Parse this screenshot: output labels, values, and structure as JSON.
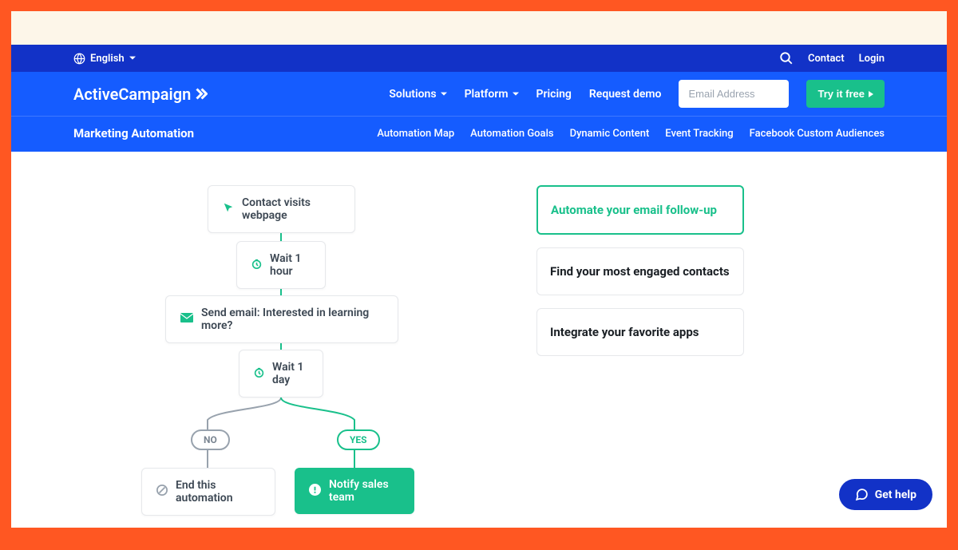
{
  "topbar": {
    "language": "English",
    "contact": "Contact",
    "login": "Login"
  },
  "mainnav": {
    "brand": "ActiveCampaign",
    "solutions": "Solutions",
    "platform": "Platform",
    "pricing": "Pricing",
    "request_demo": "Request demo",
    "email_placeholder": "Email Address",
    "try_free": "Try it free"
  },
  "subnav": {
    "title": "Marketing Automation",
    "links": [
      "Automation Map",
      "Automation Goals",
      "Dynamic Content",
      "Event Tracking",
      "Facebook Custom Audiences"
    ]
  },
  "flow": {
    "step1": "Contact visits webpage",
    "step2": "Wait 1 hour",
    "step3": "Send email: Interested in learning more?",
    "step4": "Wait 1 day",
    "no_label": "NO",
    "yes_label": "YES",
    "end": "End this automation",
    "notify": "Notify sales team"
  },
  "cards": {
    "c1": "Automate your email follow-up",
    "c2": "Find your most engaged contacts",
    "c3": "Integrate your favorite apps"
  },
  "help": "Get help",
  "colors": {
    "accent_green": "#19c08b",
    "brand_blue": "#155cff",
    "dark_blue": "#1232c7",
    "frame_orange": "#ff5722"
  }
}
